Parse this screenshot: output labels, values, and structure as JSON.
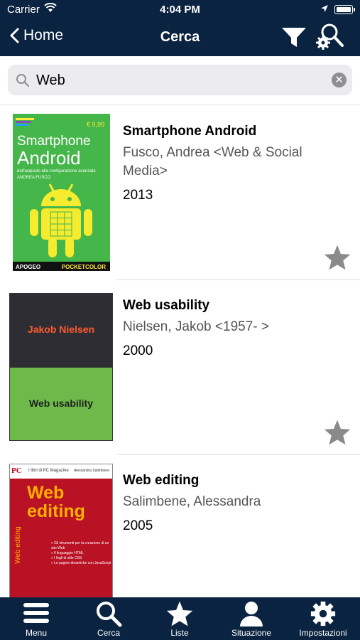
{
  "status_bar": {
    "carrier": "Carrier",
    "time": "4:04 PM"
  },
  "nav": {
    "back_label": "Home",
    "title": "Cerca"
  },
  "search": {
    "value": "Web"
  },
  "results": [
    {
      "title": "Smartphone Android",
      "author": "Fusco, Andrea  <Web & Social Media>",
      "year": "2013",
      "cover": {
        "price": "€ 9,90",
        "line1": "Smartphone",
        "line2": "Android",
        "line3": "dall'acquisto alla configurazione avanzata",
        "line4": "ANDREA FUSCO",
        "publisher": "APOGEO",
        "series": "POCKETCOLOR"
      }
    },
    {
      "title": "Web usability",
      "author": "Nielsen, Jakob <1957- >",
      "year": "2000",
      "cover": {
        "author": "Jakob Nielsen",
        "title": "Web usability"
      }
    },
    {
      "title": "Web editing",
      "author": "Salimbene, Alessandra",
      "year": "2005",
      "cover": {
        "logo": "PC",
        "magazine": "I libri di PC Magazine",
        "author": "Alessandra Salimbene",
        "title1": "Web",
        "title2": "editing",
        "side": "Web editing",
        "bullets": [
          "» Gli strumenti per la creazione di un sito Web",
          "» Il linguaggio HTML",
          "» I fogli di stile CSS",
          "» Le pagine dinamiche con JavaScript"
        ]
      }
    }
  ],
  "tabs": [
    {
      "label": "Menu",
      "icon": "menu-icon"
    },
    {
      "label": "Cerca",
      "icon": "search-icon"
    },
    {
      "label": "Liste",
      "icon": "star-icon"
    },
    {
      "label": "Situazione",
      "icon": "user-icon"
    },
    {
      "label": "Impostazioni",
      "icon": "gear-icon"
    }
  ],
  "colors": {
    "navbar": "#0a2340",
    "star": "#8a8a8a"
  }
}
